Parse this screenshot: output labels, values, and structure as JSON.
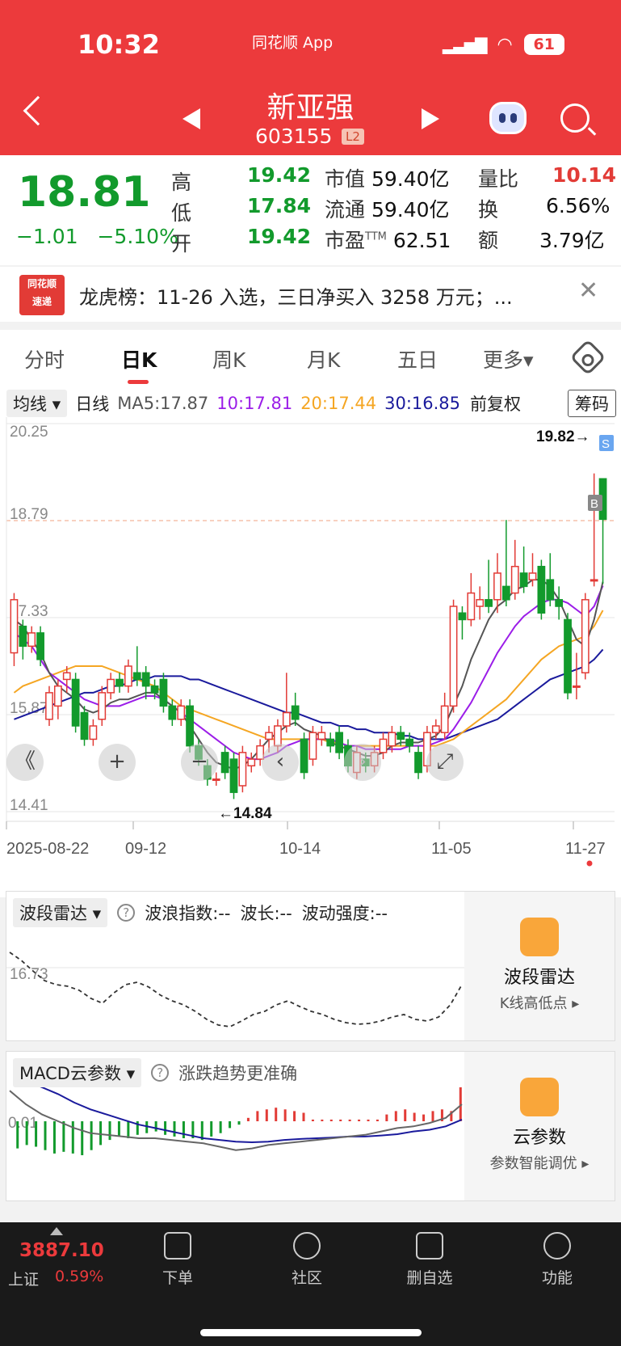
{
  "status": {
    "time": "10:32",
    "app": "同花顺 App",
    "battery": "61"
  },
  "header": {
    "name": "新亚强",
    "code": "603155",
    "level": "L2"
  },
  "quote": {
    "price": "18.81",
    "change": "−1.01",
    "change_pct": "−5.10%",
    "high_label": "高",
    "high": "19.42",
    "low_label": "低",
    "low": "17.84",
    "open_label": "开",
    "open": "19.42",
    "mcap_label": "市值",
    "mcap": "59.40亿",
    "float_label": "流通",
    "float": "59.40亿",
    "pe_label": "市盈",
    "pe_sup": "TTM",
    "pe": "62.51",
    "vr_label": "量比",
    "vr": "10.14",
    "turn_label": "换",
    "turn": "6.56%",
    "amt_label": "额",
    "amt": "3.79亿",
    "colors": {
      "down": "#129a2c",
      "up": "#e23b36"
    }
  },
  "news": {
    "logo_top": "同花顺",
    "logo_bottom": "速递",
    "text": "龙虎榜：11-26 入选，三日净买入 3258 万元；..."
  },
  "tabs": [
    {
      "label": "分时"
    },
    {
      "label": "日K",
      "active": true
    },
    {
      "label": "周K"
    },
    {
      "label": "月K"
    },
    {
      "label": "五日"
    },
    {
      "label": "更多▾"
    }
  ],
  "kline": {
    "ma_select": "均线 ▾",
    "period": "日线",
    "ma5": "MA5:17.87",
    "ma10": "10:17.81",
    "ma20": "20:17.44",
    "ma30": "30:16.85",
    "adjust": "前复权",
    "chip": "筹码",
    "ma_colors": {
      "ma5": "#555555",
      "ma10": "#9b1de8",
      "ma20": "#f5a623",
      "ma30": "#1a1a9c"
    },
    "price_ticks": [
      "20.25",
      "18.79",
      "17.33",
      "15.87",
      "14.41"
    ],
    "high_mark": "19.82→",
    "low_mark": "←14.84",
    "s_tag": "S",
    "b_tag": "B",
    "dates": [
      "2025-08-22",
      "09-12",
      "10-14",
      "11-05",
      "11-27"
    ],
    "controls": [
      "《",
      "+",
      "−",
      "‹",
      "›",
      "⤢"
    ]
  },
  "chart_data": {
    "type": "candlestick",
    "ylim": [
      14.41,
      20.25
    ],
    "x_ticks": [
      "2025-08-22",
      "09-12",
      "10-14",
      "11-05",
      "11-27"
    ],
    "candles": [
      [
        16.8,
        17.6,
        16.6,
        17.7
      ],
      [
        17.2,
        16.9,
        16.7,
        17.3
      ],
      [
        16.9,
        17.1,
        16.8,
        17.2
      ],
      [
        17.1,
        16.7,
        16.6,
        17.2
      ],
      [
        15.8,
        16.2,
        15.7,
        16.3
      ],
      [
        16.0,
        16.3,
        15.8,
        16.4
      ],
      [
        16.4,
        16.5,
        16.2,
        16.6
      ],
      [
        16.4,
        15.7,
        15.6,
        16.5
      ],
      [
        15.9,
        15.5,
        15.4,
        16.0
      ],
      [
        15.5,
        15.7,
        15.4,
        15.8
      ],
      [
        15.8,
        16.2,
        15.7,
        16.3
      ],
      [
        16.2,
        16.4,
        16.1,
        16.5
      ],
      [
        16.4,
        16.3,
        16.2,
        16.5
      ],
      [
        16.3,
        16.6,
        16.2,
        16.7
      ],
      [
        16.5,
        16.4,
        16.3,
        16.9
      ],
      [
        16.5,
        16.3,
        16.1,
        16.6
      ],
      [
        16.3,
        16.2,
        16.1,
        16.4
      ],
      [
        16.4,
        16.0,
        15.9,
        16.5
      ],
      [
        16.0,
        15.8,
        15.7,
        16.1
      ],
      [
        15.8,
        16.0,
        15.7,
        16.1
      ],
      [
        16.0,
        15.4,
        15.3,
        16.1
      ],
      [
        15.4,
        15.2,
        15.1,
        15.5
      ],
      [
        15.1,
        14.9,
        14.8,
        15.2
      ],
      [
        14.9,
        14.9,
        14.8,
        15.0
      ],
      [
        15.3,
        15.0,
        14.9,
        15.4
      ],
      [
        15.2,
        14.7,
        14.6,
        15.3
      ],
      [
        14.8,
        15.3,
        14.7,
        15.4
      ],
      [
        15.1,
        15.2,
        15.0,
        15.3
      ],
      [
        15.2,
        15.4,
        15.1,
        15.5
      ],
      [
        15.5,
        15.6,
        15.3,
        15.7
      ],
      [
        15.4,
        15.7,
        15.3,
        15.8
      ],
      [
        15.7,
        15.9,
        15.6,
        16.5
      ],
      [
        16.0,
        15.8,
        15.7,
        16.2
      ],
      [
        15.5,
        15.0,
        14.9,
        15.6
      ],
      [
        15.2,
        15.6,
        15.1,
        15.7
      ],
      [
        15.5,
        15.6,
        15.4,
        15.7
      ],
      [
        15.5,
        15.4,
        15.3,
        15.6
      ],
      [
        15.6,
        15.3,
        15.2,
        15.7
      ],
      [
        15.4,
        15.1,
        15.0,
        15.5
      ],
      [
        15.0,
        15.3,
        14.9,
        15.4
      ],
      [
        15.2,
        15.1,
        15.0,
        15.3
      ],
      [
        15.1,
        15.3,
        15.0,
        15.4
      ],
      [
        15.3,
        15.5,
        15.2,
        15.6
      ],
      [
        15.4,
        15.6,
        15.3,
        15.7
      ],
      [
        15.6,
        15.5,
        15.4,
        15.7
      ],
      [
        15.5,
        15.4,
        15.3,
        15.6
      ],
      [
        15.3,
        15.0,
        14.9,
        15.4
      ],
      [
        15.1,
        15.6,
        15.0,
        15.7
      ],
      [
        15.6,
        15.7,
        15.5,
        15.8
      ],
      [
        15.6,
        16.0,
        15.5,
        16.2
      ],
      [
        16.0,
        17.5,
        15.9,
        17.6
      ],
      [
        17.4,
        17.3,
        17.0,
        17.5
      ],
      [
        17.3,
        17.7,
        17.2,
        18.0
      ],
      [
        17.5,
        17.6,
        17.3,
        17.8
      ],
      [
        17.6,
        17.5,
        17.4,
        18.2
      ],
      [
        17.6,
        18.0,
        17.4,
        18.3
      ],
      [
        17.8,
        17.6,
        17.5,
        18.8
      ],
      [
        17.7,
        18.1,
        17.6,
        18.5
      ],
      [
        18.0,
        17.8,
        17.7,
        18.4
      ],
      [
        17.9,
        18.0,
        17.8,
        18.3
      ],
      [
        18.1,
        17.4,
        17.3,
        18.2
      ],
      [
        17.9,
        17.6,
        17.5,
        18.3
      ],
      [
        17.6,
        17.5,
        17.3,
        17.8
      ],
      [
        17.3,
        16.2,
        16.1,
        17.4
      ],
      [
        16.3,
        16.3,
        16.1,
        16.8
      ],
      [
        16.5,
        17.6,
        16.4,
        17.7
      ],
      [
        17.9,
        17.9,
        17.8,
        19.5
      ],
      [
        19.42,
        18.81,
        17.84,
        19.42
      ]
    ],
    "ma5": [
      17.3,
      17.2,
      17.0,
      16.8,
      16.5,
      16.3,
      16.2,
      16.1,
      15.95,
      15.9,
      15.95,
      16.05,
      16.1,
      16.1,
      16.15,
      16.2,
      16.2,
      16.1,
      16.0,
      15.9,
      15.7,
      15.5,
      15.3,
      15.15,
      15.1,
      15.05,
      15.1,
      15.2,
      15.35,
      15.5,
      15.6,
      15.7,
      15.75,
      15.65,
      15.6,
      15.55,
      15.45,
      15.4,
      15.35,
      15.3,
      15.25,
      15.25,
      15.3,
      15.4,
      15.45,
      15.45,
      15.45,
      15.5,
      15.55,
      15.7,
      16.0,
      16.3,
      16.7,
      17.0,
      17.3,
      17.5,
      17.6,
      17.75,
      17.8,
      17.9,
      17.9,
      17.8,
      17.6,
      17.3,
      17.0,
      16.9,
      17.3,
      17.87
    ],
    "ma10": [
      17.1,
      17.0,
      16.9,
      16.7,
      16.5,
      16.4,
      16.3,
      16.2,
      16.1,
      16.05,
      16.0,
      16.0,
      16.0,
      16.05,
      16.1,
      16.15,
      16.15,
      16.1,
      16.0,
      15.9,
      15.8,
      15.7,
      15.6,
      15.5,
      15.4,
      15.3,
      15.25,
      15.2,
      15.2,
      15.25,
      15.3,
      15.4,
      15.45,
      15.5,
      15.5,
      15.5,
      15.5,
      15.45,
      15.4,
      15.4,
      15.35,
      15.35,
      15.35,
      15.35,
      15.35,
      15.4,
      15.4,
      15.4,
      15.45,
      15.5,
      15.65,
      15.85,
      16.05,
      16.3,
      16.55,
      16.8,
      17.0,
      17.2,
      17.35,
      17.45,
      17.55,
      17.6,
      17.6,
      17.55,
      17.45,
      17.35,
      17.5,
      17.81
    ],
    "ma20": [
      16.2,
      16.3,
      16.35,
      16.4,
      16.45,
      16.5,
      16.55,
      16.6,
      16.6,
      16.6,
      16.6,
      16.55,
      16.5,
      16.45,
      16.4,
      16.35,
      16.3,
      16.2,
      16.1,
      16.0,
      15.95,
      15.9,
      15.85,
      15.8,
      15.75,
      15.7,
      15.65,
      15.6,
      15.55,
      15.5,
      15.5,
      15.5,
      15.5,
      15.5,
      15.5,
      15.5,
      15.45,
      15.45,
      15.4,
      15.4,
      15.4,
      15.4,
      15.4,
      15.4,
      15.4,
      15.4,
      15.4,
      15.4,
      15.4,
      15.45,
      15.5,
      15.6,
      15.7,
      15.8,
      15.9,
      16.0,
      16.1,
      16.25,
      16.4,
      16.55,
      16.7,
      16.8,
      16.9,
      16.95,
      17.0,
      17.05,
      17.2,
      17.44
    ],
    "ma30": [
      15.8,
      15.85,
      15.9,
      15.95,
      16.0,
      16.05,
      16.1,
      16.15,
      16.2,
      16.2,
      16.25,
      16.3,
      16.3,
      16.35,
      16.4,
      16.4,
      16.45,
      16.45,
      16.45,
      16.45,
      16.4,
      16.4,
      16.35,
      16.3,
      16.25,
      16.2,
      16.15,
      16.1,
      16.05,
      16.0,
      15.95,
      15.9,
      15.9,
      15.85,
      15.8,
      15.75,
      15.75,
      15.7,
      15.7,
      15.65,
      15.65,
      15.6,
      15.6,
      15.6,
      15.55,
      15.55,
      15.5,
      15.5,
      15.5,
      15.5,
      15.55,
      15.6,
      15.65,
      15.7,
      15.75,
      15.8,
      15.9,
      16.0,
      16.1,
      16.2,
      16.3,
      16.4,
      16.45,
      16.5,
      16.55,
      16.6,
      16.7,
      16.85
    ]
  },
  "wave": {
    "select": "波段雷达 ▾",
    "q": "?",
    "index": "波浪指数:--",
    "length": "波长:--",
    "strength": "波动强度:--",
    "tick": "16.73",
    "side_title": "波段雷达",
    "side_sub": "K线高低点 ▸",
    "series": [
      0.95,
      0.85,
      0.72,
      0.6,
      0.55,
      0.53,
      0.48,
      0.38,
      0.32,
      0.45,
      0.55,
      0.58,
      0.52,
      0.42,
      0.35,
      0.3,
      0.22,
      0.12,
      0.05,
      0.03,
      0.1,
      0.18,
      0.22,
      0.3,
      0.35,
      0.28,
      0.22,
      0.18,
      0.12,
      0.08,
      0.06,
      0.07,
      0.1,
      0.15,
      0.18,
      0.12,
      0.1,
      0.15,
      0.3,
      0.55
    ]
  },
  "macd": {
    "select": "MACD云参数 ▾",
    "q": "?",
    "hint": "涨跌趋势更准确",
    "tick": "0.01",
    "side_title": "云参数",
    "side_sub": "参数智能调优 ▸",
    "hist": [
      -0.8,
      -0.7,
      -0.75,
      -0.85,
      -0.95,
      -0.9,
      -0.95,
      -1.0,
      -0.85,
      -0.7,
      -0.55,
      -0.45,
      -0.5,
      -0.4,
      -0.35,
      -0.3,
      -0.4,
      -0.45,
      -0.5,
      -0.5,
      -0.55,
      -0.45,
      -0.35,
      -0.2,
      -0.1,
      0.1,
      0.3,
      0.35,
      0.4,
      0.35,
      0.3,
      0.25,
      0.05,
      0.05,
      0.05,
      0.05,
      0.05,
      0.05,
      0.05,
      0.05,
      0.2,
      0.3,
      0.35,
      0.25,
      0.2,
      0.3,
      0.35,
      0.3,
      1.0
    ],
    "dif": [
      0.9,
      0.5,
      0.2,
      0.0,
      -0.2,
      -0.35,
      -0.4,
      -0.45,
      -0.5,
      -0.5,
      -0.55,
      -0.6,
      -0.65,
      -0.75,
      -0.85,
      -0.8,
      -0.7,
      -0.65,
      -0.6,
      -0.55,
      -0.5,
      -0.45,
      -0.4,
      -0.3,
      -0.2,
      -0.15,
      -0.05,
      0.1,
      0.5
    ],
    "dea": [
      1.3,
      1.2,
      1.0,
      0.8,
      0.55,
      0.35,
      0.2,
      0.05,
      -0.1,
      -0.2,
      -0.3,
      -0.4,
      -0.5,
      -0.55,
      -0.6,
      -0.62,
      -0.6,
      -0.55,
      -0.52,
      -0.5,
      -0.48,
      -0.45,
      -0.45,
      -0.42,
      -0.38,
      -0.3,
      -0.25,
      -0.15,
      0.05
    ]
  },
  "bottom": {
    "index_value": "3887.10",
    "index_name": "上证",
    "index_pct": "0.59%",
    "tabs": [
      {
        "label": "下单"
      },
      {
        "label": "社区"
      },
      {
        "label": "删自选"
      },
      {
        "label": "功能"
      }
    ]
  }
}
